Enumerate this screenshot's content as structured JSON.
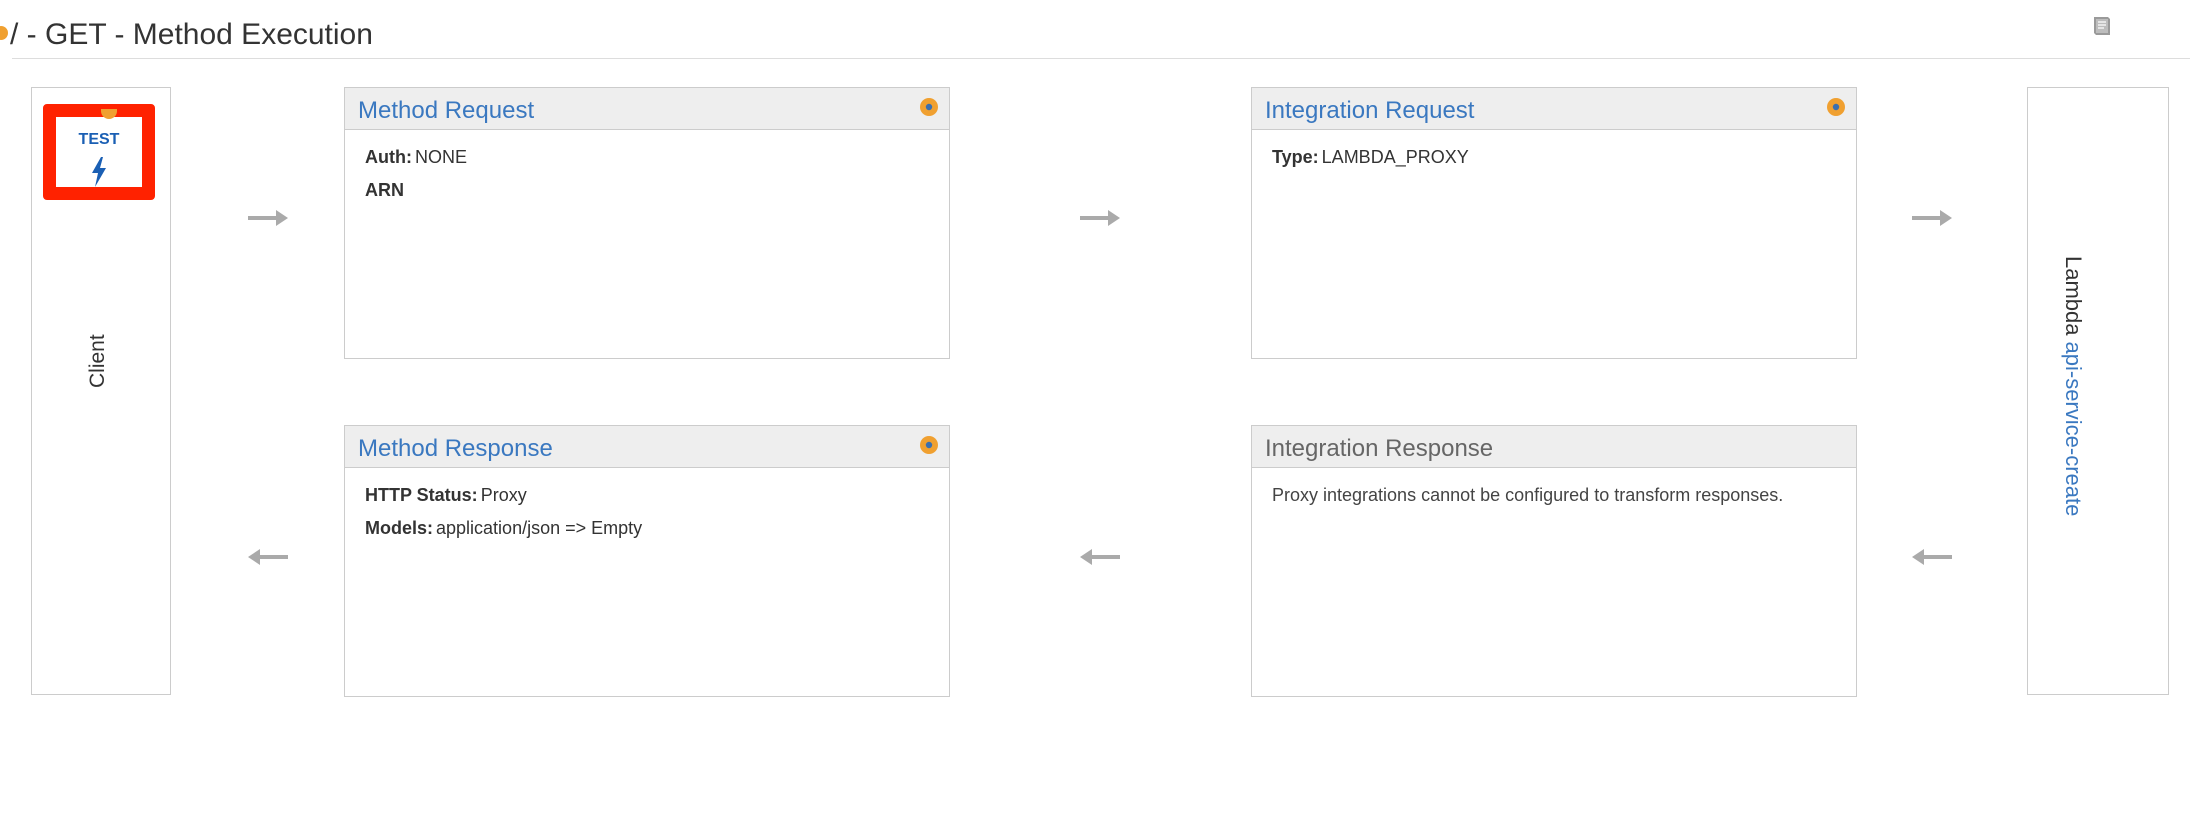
{
  "header": {
    "title": "/ - GET - Method Execution",
    "help_icon": "book-icon"
  },
  "client": {
    "test_label": "TEST",
    "test_icon": "lightning-bolt-icon",
    "label": "Client"
  },
  "method_request": {
    "title": "Method Request",
    "auth_key": "Auth:",
    "auth_value": "NONE",
    "arn_key": "ARN"
  },
  "integration_request": {
    "title": "Integration Request",
    "type_key": "Type:",
    "type_value": "LAMBDA_PROXY"
  },
  "method_response": {
    "title": "Method Response",
    "status_key": "HTTP Status:",
    "status_value": "Proxy",
    "models_key": "Models:",
    "models_value": "application/json => Empty"
  },
  "integration_response": {
    "title": "Integration Response",
    "note": "Proxy integrations cannot be configured to transform responses."
  },
  "lambda": {
    "prefix": "Lambda",
    "function_name": "api-service-create"
  },
  "colors": {
    "link_blue": "#3a78c0",
    "test_border": "#ff2200",
    "accent_orange": "#f0a030",
    "arrow_grey": "#aaaaaa"
  }
}
